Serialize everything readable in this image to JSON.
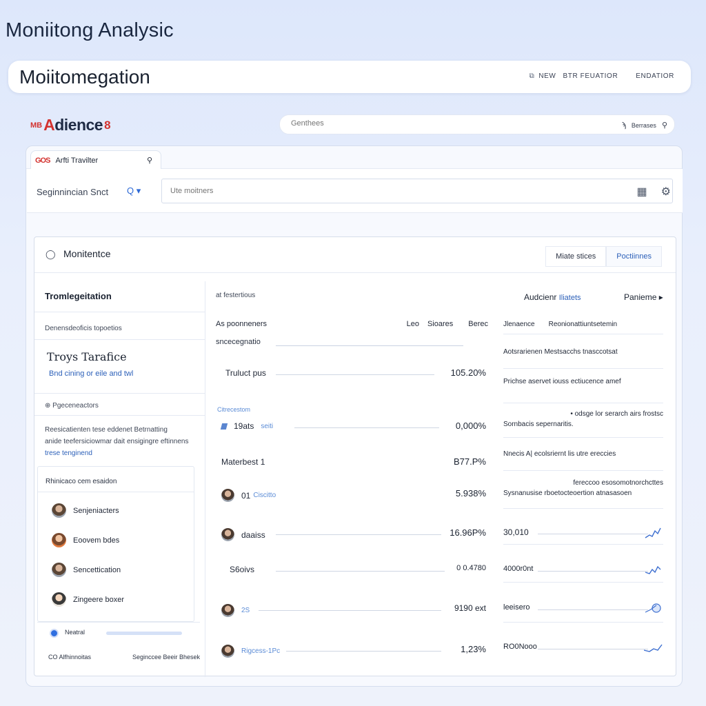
{
  "page_title": "Moniitong Analysic",
  "topbar": {
    "title": "Moiitomegation",
    "nav": [
      "NEW",
      "BTR FEUATIOR",
      "ENDATIOR"
    ]
  },
  "brand": {
    "mark": "MB",
    "name_prefix": "A",
    "name_rest": "dience",
    "sup": "8"
  },
  "global_search": {
    "placeholder": "Genthees",
    "right_label": "Berrases"
  },
  "tab": {
    "logo": "GOS",
    "label": "Arfti Travilter"
  },
  "filter": {
    "label": "Seginnincian Snct",
    "search_caret": "Q ▾",
    "input_placeholder": "Ute moitners"
  },
  "card": {
    "title": "Monitentce",
    "actions": [
      "Miate stices",
      "Poctiinnes"
    ]
  },
  "left": {
    "title": "Tromlegeitation",
    "section1": "Denensdeoficis topoetios",
    "big_title": "Troys Tarafice",
    "link": "Bnd cining or eile and twl",
    "section2": "⊕ Pgeceneactors",
    "para_line1": "Reesicatienten tese eddenet Betrnatting",
    "para_line2": "anide teefersiciowmar dait ensigingre eftinnens",
    "para_line3": "trese tenginend",
    "user_list_title": "Rhinicaco cem esaidon",
    "users": [
      "Senjeniacters",
      "Eoovem bdes",
      "Sencettication",
      "Zingeere boxer"
    ],
    "footer_label": "Neatral",
    "footer_left": "CO Alfhinnoitas",
    "footer_right": "Seginccee Beeir Bhesek"
  },
  "middle": {
    "head": "at festertious",
    "col_a": "As poonneners",
    "col_b": "Leo",
    "col_c": "Sioares",
    "col_d": "Berec",
    "sub": "sncecegnatio",
    "group_label": "Citrecestom",
    "rows": [
      {
        "label": "Truluct pus",
        "sub": "",
        "value": "105.20%"
      },
      {
        "label": "19ats",
        "sub": "seiti",
        "value": "0,000%"
      },
      {
        "label": "Materbest  1",
        "sub": "",
        "value": "B77.P%"
      },
      {
        "label": "01",
        "sub": "Ciscitto",
        "value": "5.938%"
      },
      {
        "label": "daaiss",
        "sub": "",
        "value": "16.96P%"
      },
      {
        "label": "S6oivs",
        "sub": "",
        "value": "0 0.4780"
      },
      {
        "label": "2S",
        "sub": "",
        "value": "9190 ext"
      },
      {
        "label": "",
        "sub": "Rigcess-1Pc",
        "value": "1,23%"
      }
    ]
  },
  "right": {
    "head_a": "Audcienr",
    "head_a_sub": "Iliatets",
    "head_b": "Panieme ▸",
    "sub_a": "Jlenaence",
    "sub_b": "Reonionattiuntsetemin",
    "text1": "Aotsrarienen Mestsacchs tnasccotsat",
    "text2": "Prichse aservet iouss ectiucence amef",
    "text3a": "• odsge lor serarch airs frostsc",
    "text3b": "Sornbacis sepernaritis.",
    "text4": "Nnecis A| ecolsriernt lis utre ereccies",
    "text5a": "fereccoo esosomotnorchcttes",
    "text5b": "Sysnanusise rboetocteoertion atnasasoen",
    "values": [
      "30,010",
      "4000r0nt",
      "leeisero",
      "RO0Nooo"
    ]
  }
}
